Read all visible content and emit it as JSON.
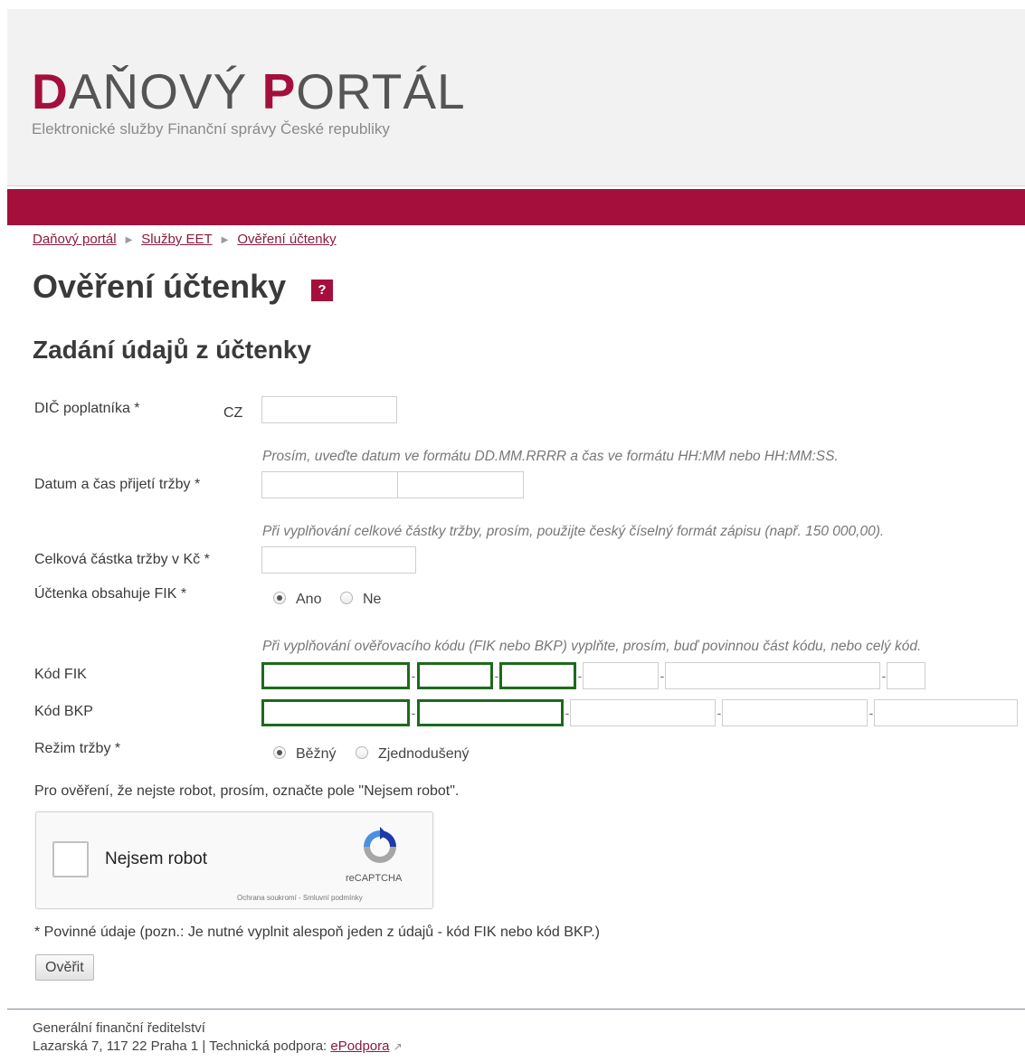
{
  "header": {
    "logo_initial_1": "D",
    "logo_rest_1": "AŇOVÝ ",
    "logo_initial_2": "P",
    "logo_rest_2": "ORTÁL",
    "tagline": "Elektronické služby Finanční správy České republiky"
  },
  "breadcrumb": [
    "Daňový portál",
    "Služby EET",
    "Ověření účtenky"
  ],
  "page_title": "Ověření účtenky",
  "help_icon_label": "?",
  "section_title": "Zadání údajů z účtenky",
  "form": {
    "dic_label": "DIČ poplatníka *",
    "dic_prefix": "CZ",
    "dic_value": "",
    "datetime_hint": "Prosím, uveďte datum ve formátu DD.MM.RRRR a čas ve formátu HH:MM nebo HH:MM:SS.",
    "datetime_label": "Datum a čas přijetí tržby *",
    "amount_hint": "Při vyplňování celkové částky tržby, prosím, použijte český číselný formát zápisu (např. 150 000,00).",
    "amount_label": "Celková částka tržby v Kč *",
    "fik_question_label": "Účtenka obsahuje FIK *",
    "fik_options": [
      {
        "label": "Ano",
        "checked": true
      },
      {
        "label": "Ne",
        "checked": false
      }
    ],
    "code_hint": "Při vyplňování ověřovacího kódu (FIK nebo BKP) vyplňte, prosím, buď povinnou část kódu, nebo celý kód.",
    "fik_label": "Kód FIK",
    "bkp_label": "Kód BKP",
    "mode_label": "Režim tržby *",
    "mode_options": [
      {
        "label": "Běžný",
        "checked": true
      },
      {
        "label": "Zjednodušený",
        "checked": false
      }
    ],
    "robot_instruction": "Pro ověření, že nejste robot, prosím, označte pole \"Nejsem robot\".",
    "required_note": "* Povinné údaje (pozn.: Je nutné vyplnit alespoň jeden z údajů - kód FIK nebo kód BKP.)",
    "submit_label": "Ověřit"
  },
  "captcha": {
    "label": "Nejsem robot",
    "brand": "reCAPTCHA",
    "links": "Ochrana soukromí - Smluvní podmínky",
    "icon": "recaptcha-icon"
  },
  "footer": {
    "org": "Generální finanční ředitelství",
    "address": "Lazarská 7, 117 22 Praha 1 | Technická podpora: ",
    "support_link": "ePodpora"
  },
  "colors": {
    "brand": "#a50f3c",
    "required_field_border": "#1b6b1b",
    "link": "#8b1a3e"
  }
}
